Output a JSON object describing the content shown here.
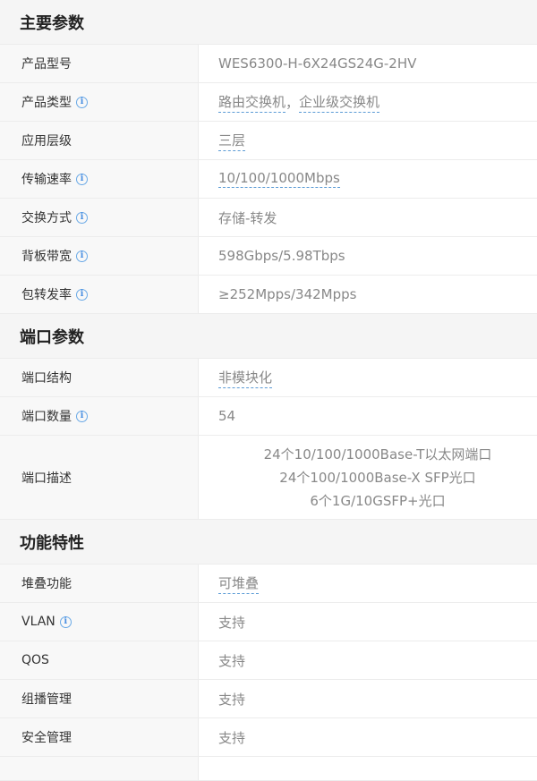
{
  "sections": [
    {
      "title": "主要参数",
      "rows": [
        {
          "label": "产品型号",
          "value": "WES6300-H-6X24GS24G-2HV"
        },
        {
          "label": "产品类型",
          "value_a": "路由交换机",
          "sep": "，",
          "value_b": "企业级交换机"
        },
        {
          "label": "应用层级",
          "value": "三层"
        },
        {
          "label": "传输速率",
          "value": "10/100/1000Mbps"
        },
        {
          "label": "交换方式",
          "value": "存储-转发"
        },
        {
          "label": "背板带宽",
          "value": "598Gbps/5.98Tbps"
        },
        {
          "label": "包转发率",
          "value": "≥252Mpps/342Mpps"
        }
      ]
    },
    {
      "title": "端口参数",
      "rows": [
        {
          "label": "端口结构",
          "value": "非模块化"
        },
        {
          "label": "端口数量",
          "value": "54"
        },
        {
          "label": "端口描述",
          "lines": [
            "24个10/100/1000Base-T以太网端口",
            "24个100/1000Base-X SFP光口",
            "6个1G/10GSFP+光口"
          ]
        }
      ]
    },
    {
      "title": "功能特性",
      "rows": [
        {
          "label": "堆叠功能",
          "value": "可堆叠"
        },
        {
          "label": "VLAN",
          "value": "支持"
        },
        {
          "label": "QOS",
          "value": "支持"
        },
        {
          "label": "组播管理",
          "value": "支持"
        },
        {
          "label": "安全管理",
          "value": "支持"
        }
      ]
    }
  ],
  "icons": {
    "info": "info-icon",
    "info_glyph": "i"
  },
  "colors": {
    "link_dash": "#5b9bd5",
    "info": "#4a90e2",
    "header_bg": "#f5f5f5",
    "label_bg": "#f8f8f8"
  }
}
